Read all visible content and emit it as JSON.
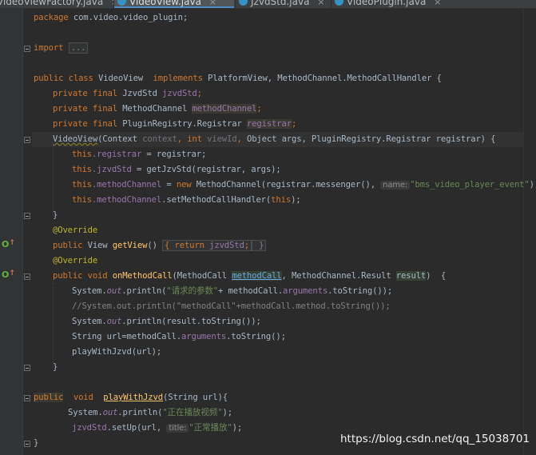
{
  "tabs": [
    {
      "label": "VideoViewFactory.java",
      "active": false
    },
    {
      "label": "VideoView.java",
      "active": true
    },
    {
      "label": "JzvdStd.java",
      "active": false
    },
    {
      "label": "VideoPlugin.java",
      "active": false
    }
  ],
  "code": {
    "l_package": {
      "kw": "package",
      "name": "com.video.video_plugin;"
    },
    "l_import": {
      "kw": "import",
      "collapsed": "..."
    },
    "l_class": {
      "kw1": "public",
      "kw2": "class",
      "name": "VideoView",
      "kw3": "implements",
      "ifaces": "PlatformView,",
      "ifaces2": "MethodChannel.MethodCallHandler {"
    },
    "l_field1": {
      "mods": "private final",
      "type": "JzvdStd",
      "name": "jzvdStd",
      "end": ";"
    },
    "l_field2": {
      "mods": "private final",
      "type": "MethodChannel",
      "name": "methodChannel",
      "end": ";"
    },
    "l_field3": {
      "mods": "private final",
      "type": "PluginRegistry.Registrar",
      "name": "registrar",
      "end": ";"
    },
    "l_ctor": {
      "name": "VideoView",
      "p1": "(Context ",
      "p1n": "context",
      "sep1": ", ",
      "kw": "int",
      "p2n": " viewId",
      "sep2": ", ",
      "rest": "Object args, PluginRegistry.Registrar registrar) {"
    },
    "l_ctor1": {
      "this": "this",
      "fld": ".registrar",
      "rest": " = registrar;"
    },
    "l_ctor2": {
      "this": "this",
      "fld": ".jzvdStd",
      "rest": " = getJzvStd(registrar, args);"
    },
    "l_ctor3": {
      "this": "this",
      "fld": ".methodChannel",
      "mid": " = ",
      "kw": "new",
      "rest": " MethodChannel(registrar.messenger(), ",
      "hint": "name:",
      "str": "\"bms_video_player_event\"",
      "end": ");"
    },
    "l_ctor4": {
      "this": "this",
      "fld": ".methodChannel",
      "rest": ".setMethodCallHandler(",
      "this2": "this",
      "end": ");"
    },
    "l_close1": "}",
    "l_override1": "@Override",
    "l_getview": {
      "kw": "public",
      "type": " View ",
      "name": "getView",
      "paren": "() ",
      "body_kw": "{ return ",
      "body_f": "jzvdStd",
      "body_end": ";",
      "close": " }"
    },
    "l_override2": "@Override",
    "l_onmethod": {
      "kw": "public void ",
      "name": "onMethodCall",
      "p1": "(MethodCall ",
      "p1n": "methodCall",
      "p2": ", MethodChannel.Result ",
      "p2n": "result",
      "end": ")  {"
    },
    "l_body1": {
      "cls": "System.",
      "out": "out",
      "call": ".println(",
      "str": "\"请求的参数\"",
      "rest": "+ methodCall.",
      "fld": "arguments",
      "end": ".toString());"
    },
    "l_body2": "//System.out.println(\"methodCall\"+methodCall.method.toString());",
    "l_body3": {
      "cls": "System.",
      "out": "out",
      "rest": ".println(result.toString());"
    },
    "l_body4": {
      "pre": "String url=methodCall.",
      "fld": "arguments",
      "rest": ".toString();"
    },
    "l_body5": "playWithJzvd(url);",
    "l_close2": "}",
    "l_play": {
      "kw1": "public",
      "kw2": "void",
      "name": "playWithJzvd",
      "rest": "(String url){"
    },
    "l_play1": {
      "cls": "System.",
      "out": "out",
      "call": ".println(",
      "str": "\"正在播放视频\"",
      "end": ");"
    },
    "l_play2": {
      "fld": "jzvdStd",
      "call": ".setUp(url, ",
      "hint": "title:",
      "str": "\"正常播放\"",
      "end": ");"
    },
    "l_close3": "}"
  },
  "watermark": "https://blog.csdn.net/qq_15038701",
  "colors": {
    "background": "#2b2b2b",
    "keyword": "#cc7832",
    "field": "#9876aa",
    "string": "#6a8759",
    "annotation": "#bbb529",
    "method": "#ffc66d",
    "comment": "#808080"
  }
}
